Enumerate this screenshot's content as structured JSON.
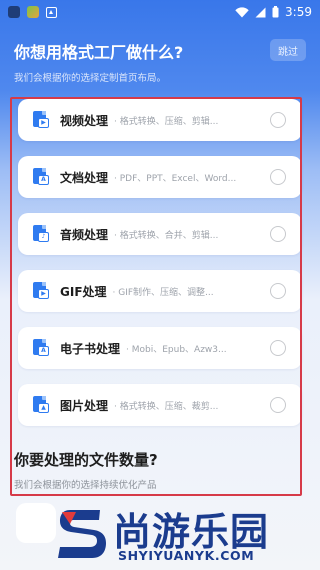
{
  "status_bar": {
    "time": "3:59",
    "icons": [
      "app-dark-icon",
      "app-color-icon",
      "app-a-icon",
      "wifi-icon",
      "signal-icon",
      "battery-icon"
    ]
  },
  "header": {
    "title": "你想用格式工厂做什么?",
    "subtitle": "我们会根据你的选择定制首页布局。",
    "skip_label": "跳过"
  },
  "options": [
    {
      "name": "视频处理",
      "desc": "· 格式转换、压缩、剪辑...",
      "icon": "video-file-icon",
      "glyph": "▶"
    },
    {
      "name": "文档处理",
      "desc": "· PDF、PPT、Excel、Word...",
      "icon": "document-file-icon",
      "glyph": "A"
    },
    {
      "name": "音频处理",
      "desc": "· 格式转换、合并、剪辑...",
      "icon": "audio-file-icon",
      "glyph": "♪"
    },
    {
      "name": "GIF处理",
      "desc": "· GIF制作、压缩、调整...",
      "icon": "gif-file-icon",
      "glyph": "▶"
    },
    {
      "name": "电子书处理",
      "desc": "· Mobi、Epub、Azw3...",
      "icon": "ebook-file-icon",
      "glyph": "A"
    },
    {
      "name": "图片处理",
      "desc": "· 格式转换、压缩、裁剪...",
      "icon": "image-file-icon",
      "glyph": "▲"
    }
  ],
  "question2": {
    "title": "你要处理的文件数量?",
    "subtitle": "我们会根据你的选择持续优化产品"
  },
  "watermark": {
    "text": "尚游乐园",
    "url": "SHYIYUANYK.COM"
  },
  "colors": {
    "accent": "#2f7bf0",
    "highlight": "#d63a48",
    "watermark": "#1b3c8e"
  }
}
